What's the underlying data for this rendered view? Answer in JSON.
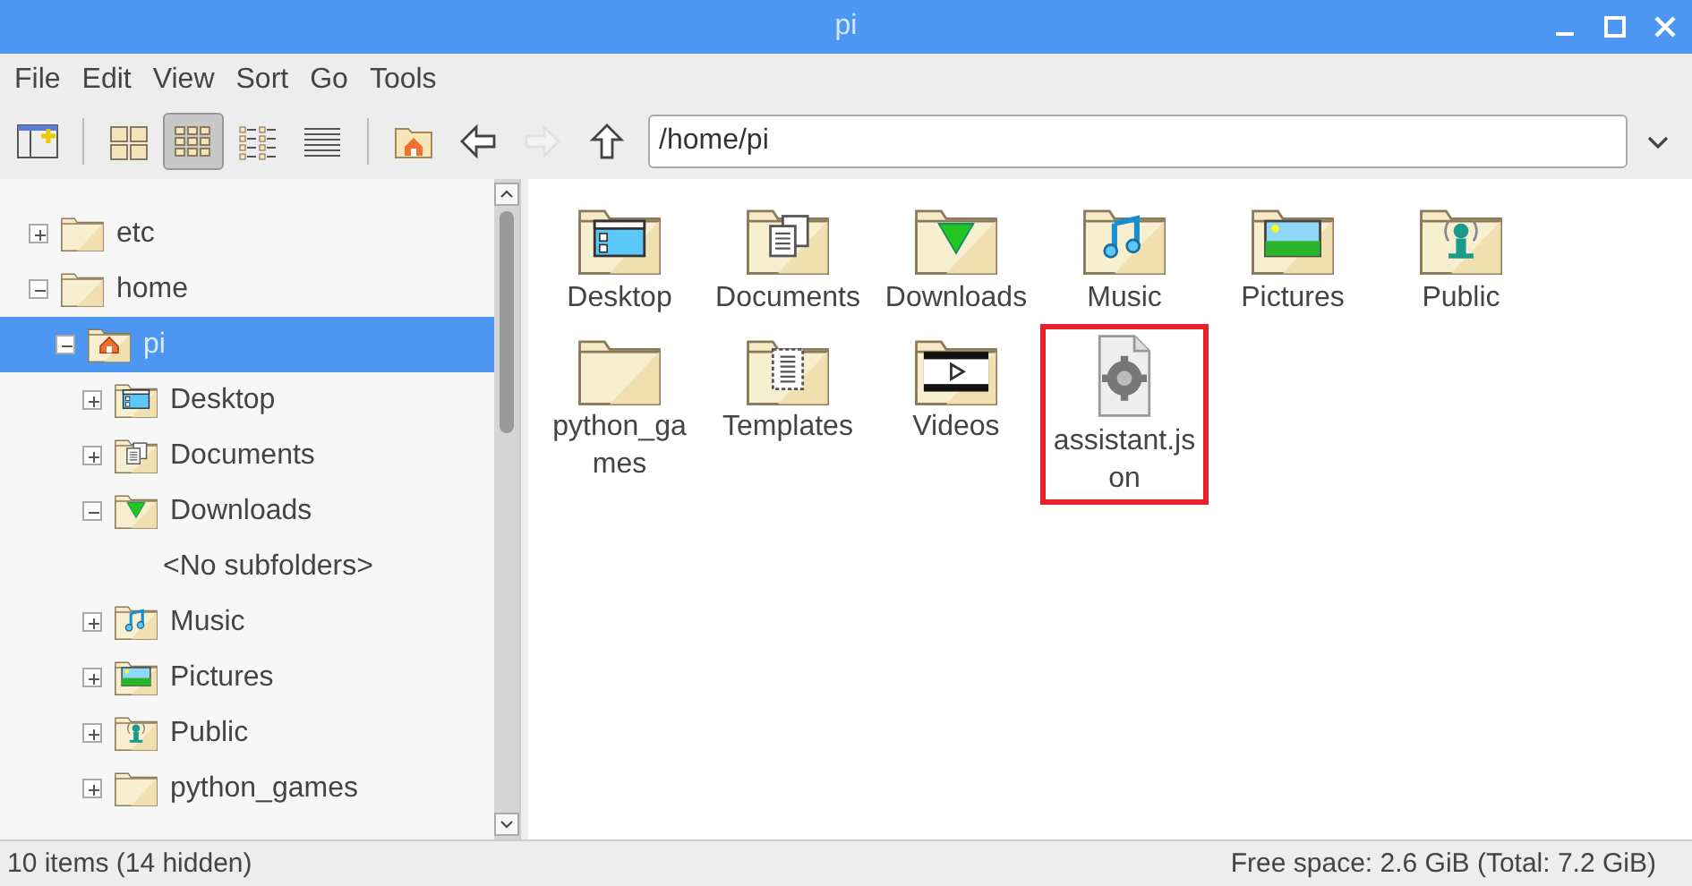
{
  "window": {
    "title": "pi"
  },
  "menu": [
    "File",
    "Edit",
    "View",
    "Sort",
    "Go",
    "Tools"
  ],
  "toolbar": {
    "view_modes": [
      {
        "kind": "thumbnails",
        "selected": false
      },
      {
        "kind": "icons",
        "selected": true
      },
      {
        "kind": "compact",
        "selected": false
      },
      {
        "kind": "list",
        "selected": false
      }
    ],
    "navigation": [
      {
        "kind": "home",
        "disabled": false
      },
      {
        "kind": "back",
        "disabled": false
      },
      {
        "kind": "forward",
        "disabled": true
      },
      {
        "kind": "up",
        "disabled": false
      }
    ],
    "path": "/home/pi"
  },
  "tree": [
    {
      "label": "etc",
      "kind": "folder",
      "expanded": false,
      "selected": false
    },
    {
      "label": "home",
      "kind": "folder",
      "expanded": true,
      "selected": false,
      "children": [
        {
          "label": "pi",
          "kind": "home",
          "expanded": true,
          "selected": true,
          "children": [
            {
              "label": "Desktop",
              "kind": "desktop",
              "expanded": false,
              "selected": false
            },
            {
              "label": "Documents",
              "kind": "documents",
              "expanded": false,
              "selected": false
            },
            {
              "label": "Downloads",
              "kind": "downloads",
              "expanded": true,
              "selected": false,
              "children": [
                {
                  "label": "<No subfolders>",
                  "kind": "placeholder"
                }
              ]
            },
            {
              "label": "Music",
              "kind": "music",
              "expanded": false,
              "selected": false
            },
            {
              "label": "Pictures",
              "kind": "pictures",
              "expanded": false,
              "selected": false
            },
            {
              "label": "Public",
              "kind": "public",
              "expanded": false,
              "selected": false
            },
            {
              "label": "python_games",
              "kind": "folder",
              "expanded": false,
              "selected": false
            }
          ]
        }
      ]
    }
  ],
  "files": [
    {
      "name": "Desktop",
      "kind": "desktop",
      "highlighted": false
    },
    {
      "name": "Documents",
      "kind": "documents",
      "highlighted": false
    },
    {
      "name": "Downloads",
      "kind": "downloads",
      "highlighted": false
    },
    {
      "name": "Music",
      "kind": "music",
      "highlighted": false
    },
    {
      "name": "Pictures",
      "kind": "pictures",
      "highlighted": false
    },
    {
      "name": "Public",
      "kind": "public",
      "highlighted": false
    },
    {
      "name": "python_games",
      "kind": "folder",
      "highlighted": false
    },
    {
      "name": "Templates",
      "kind": "templates",
      "highlighted": false
    },
    {
      "name": "Videos",
      "kind": "videos",
      "highlighted": false
    },
    {
      "name": "assistant.json",
      "kind": "file",
      "highlighted": true
    }
  ],
  "status_bar": {
    "items": "10 items (14 hidden)",
    "free_space": "Free space: 2.6 GiB (Total: 7.2 GiB)"
  }
}
